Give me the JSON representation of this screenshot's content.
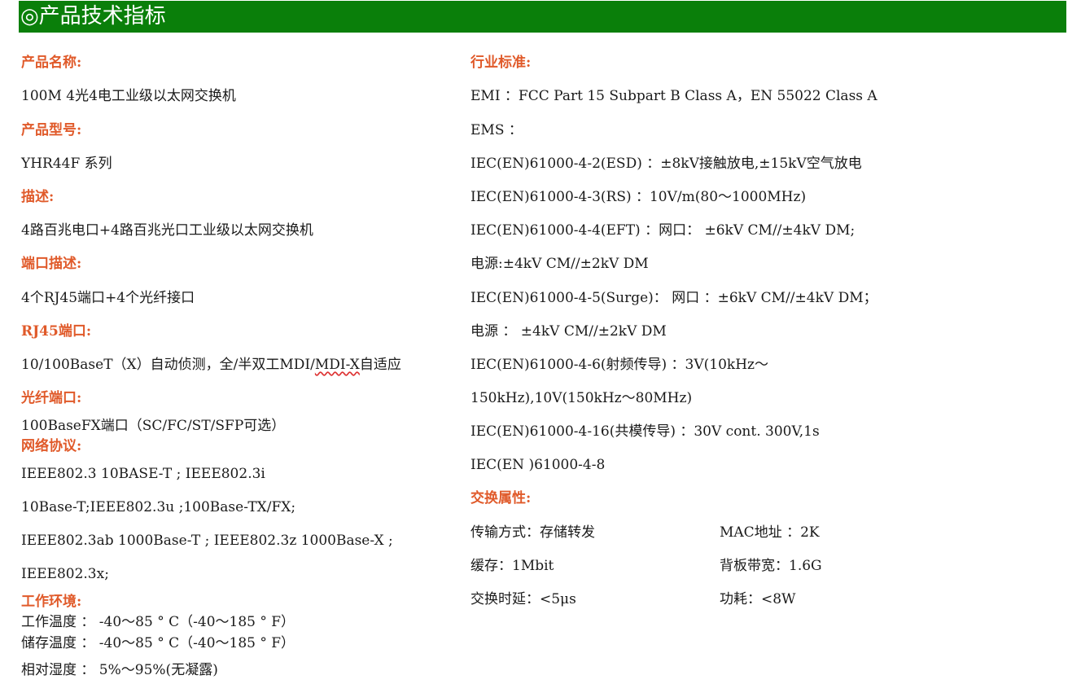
{
  "title": "◎产品技术指标",
  "left": {
    "product_name_label": "产品名称:",
    "product_name": "100M 4光4电工业级以太网交换机",
    "model_label": "产品型号:",
    "model": "YHR44F 系列",
    "desc_label": "描述:",
    "desc": "4路百兆电口+4路百兆光口工业级以太网交换机",
    "port_desc_label": "端口描述:",
    "port_desc": "4个RJ45端口+4个光纤接口",
    "rj45_label": "RJ45端口:",
    "rj45_prefix": "10/100BaseT（X）自动侦测，全/半双工MDI/",
    "rj45_underlined": "MDI-X",
    "rj45_suffix": "自适应",
    "fiber_label": "光纤端口:",
    "fiber": "100BaseFX端口（SC/FC/ST/SFP可选）",
    "protocol_label": "网络协议:",
    "protocol_lines": [
      "IEEE802.3 10BASE-T ; IEEE802.3i",
      "10Base-T;IEEE802.3u ;100Base-TX/FX;",
      "IEEE802.3ab 1000Base-T ; IEEE802.3z 1000Base-X ;",
      "IEEE802.3x;"
    ],
    "env_label": "工作环境:",
    "env_lines": [
      "工作温度 ： -40～85 ° C（-40～185 ° F）",
      "储存温度 ： -40～85 ° C（-40～185 ° F）",
      "相对湿度 ： 5%～95%(无凝露)"
    ]
  },
  "right": {
    "standard_label": "行业标准:",
    "standard_lines": [
      "EMI ：FCC Part 15 Subpart B Class A，EN 55022 Class A",
      "EMS ：",
      "IEC(EN)61000-4-2(ESD) ：±8kV接触放电,±15kV空气放电",
      "IEC(EN)61000-4-3(RS) ：10V/m(80～1000MHz)",
      "IEC(EN)61000-4-4(EFT) ：网口： ±6kV CM//±4kV DM;",
      "电源:±4kV CM//±2kV DM",
      "IEC(EN)61000-4-5(Surge)： 网口 ：±6kV CM//±4kV DM；",
      "电源 ： ±4kV CM//±2kV DM",
      "IEC(EN)61000-4-6(射频传导) ：3V(10kHz～",
      "150kHz),10V(150kHz～80MHz)",
      "IEC(EN)61000-4-16(共模传导) ：30V cont. 300V,1s",
      "IEC(EN )61000-4-8"
    ],
    "switch_label": "交换属性:",
    "switch_items": [
      {
        "left": "传输方式：存储转发",
        "right": "MAC地址 ：2K"
      },
      {
        "left": "缓存：1Mbit",
        "right": "背板带宽：1.6G"
      },
      {
        "left": "交换时延：<5μs",
        "right": "功耗：<8W"
      }
    ]
  }
}
